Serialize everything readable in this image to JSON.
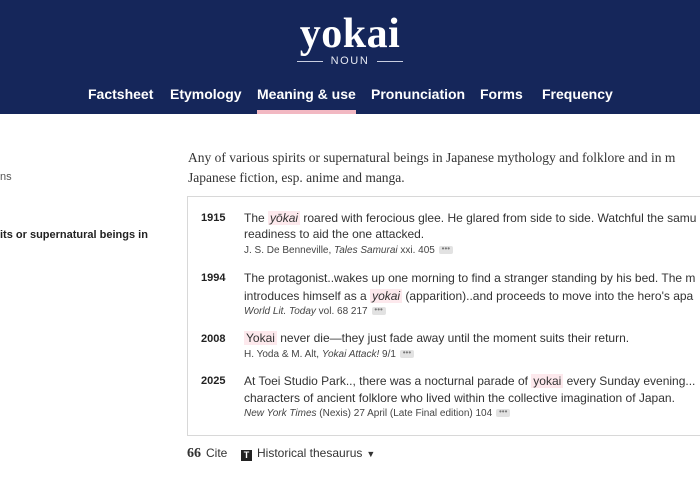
{
  "header": {
    "title": "yokai",
    "part_of_speech": "NOUN",
    "tabs": [
      {
        "label": "Factsheet"
      },
      {
        "label": "Etymology"
      },
      {
        "label": "Meaning & use"
      },
      {
        "label": "Pronunciation"
      },
      {
        "label": "Forms"
      },
      {
        "label": "Frequency"
      }
    ],
    "active_tab": "Meaning & use",
    "background_color": "#15265a",
    "active_underline_color": "#f2b8c2"
  },
  "sidebar": {
    "item_a": "ns",
    "item_b": "its or supernatural beings in"
  },
  "definition": {
    "line1": "Any of various spirits or supernatural beings in Japanese mythology and folklore and in m",
    "line2": "Japanese fiction, esp. anime and manga."
  },
  "quotations": [
    {
      "year": "1915",
      "pre": "The ",
      "term": "yōkai",
      "post": " roared with ferocious glee. He glared from side to side. Watchful the samu",
      "line2": "readiness to aid the one attacked.",
      "source_plain": "J. S. De Benneville, ",
      "source_italic": "Tales Samurai",
      "source_rest": " xxi. 405"
    },
    {
      "year": "1994",
      "line1": "The protagonist..wakes up one morning to find a stranger standing by his bed. The m",
      "pre": "introduces himself as a ",
      "term": "yokai",
      "post": " (apparition)..and proceeds to move into the hero's apa",
      "source_plain": "",
      "source_italic": "World Lit. Today",
      "source_rest": " vol. 68 217"
    },
    {
      "year": "2008",
      "pre": "",
      "term": "Yokai",
      "post": " never die—they just fade away until the moment suits their return.",
      "source_plain": "H. Yoda & M. Alt, ",
      "source_italic": "Yokai Attack!",
      "source_rest": " 9/1"
    },
    {
      "year": "2025",
      "pre": "At Toei Studio Park.., there was a nocturnal parade of ",
      "term": "yokai",
      "post": " every Sunday evening...",
      "line2": "characters of ancient folklore who lived within the collective imagination of Japan.",
      "source_plain": "",
      "source_italic": "New York Times",
      "source_rest": " (Nexis) 27 April (Late Final edition) 104"
    }
  ],
  "more_glyph": "•••",
  "tools": {
    "cite_icon": "66",
    "cite_label": "Cite",
    "thesaurus_icon": "T",
    "thesaurus_label": "Historical thesaurus",
    "thesaurus_caret": "▼"
  },
  "highlight_color": "#fde9ed"
}
